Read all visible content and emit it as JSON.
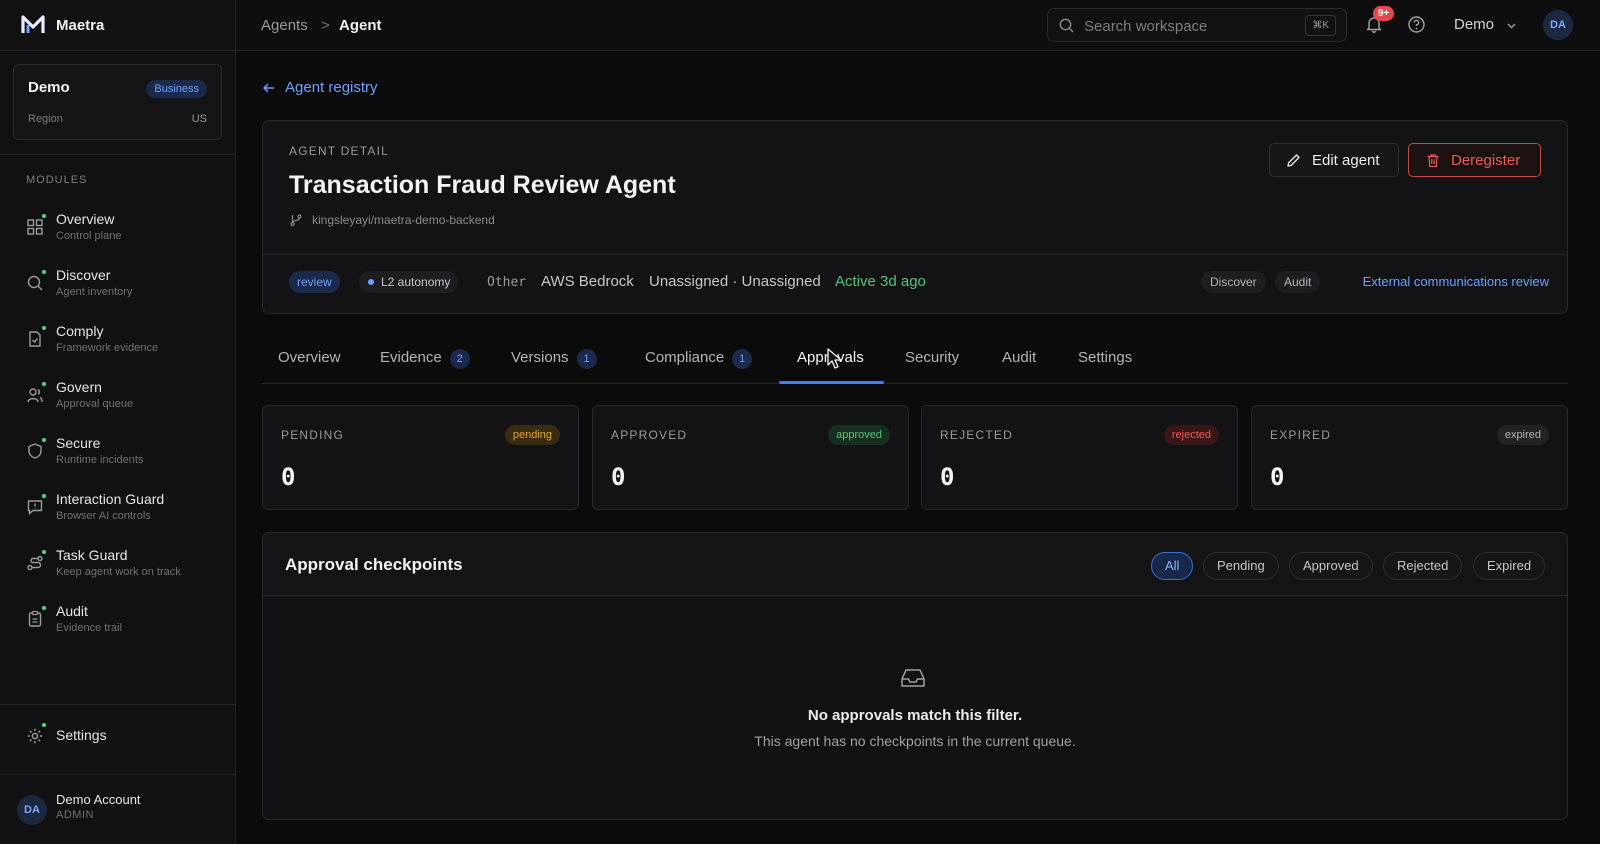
{
  "app": {
    "name": "Maetra"
  },
  "workspace": {
    "name": "Demo",
    "plan": "Business",
    "region_label": "Region",
    "region_value": "US"
  },
  "sidebar": {
    "section_label": "MODULES",
    "items": [
      {
        "title": "Overview",
        "subtitle": "Control plane",
        "icon": "grid-icon"
      },
      {
        "title": "Discover",
        "subtitle": "Agent inventory",
        "icon": "search-icon"
      },
      {
        "title": "Comply",
        "subtitle": "Framework evidence",
        "icon": "document-check-icon"
      },
      {
        "title": "Govern",
        "subtitle": "Approval queue",
        "icon": "users-icon"
      },
      {
        "title": "Secure",
        "subtitle": "Runtime incidents",
        "icon": "shield-icon"
      },
      {
        "title": "Interaction Guard",
        "subtitle": "Browser AI controls",
        "icon": "message-alert-icon"
      },
      {
        "title": "Task Guard",
        "subtitle": "Keep agent work on track",
        "icon": "route-icon"
      },
      {
        "title": "Audit",
        "subtitle": "Evidence trail",
        "icon": "clipboard-icon"
      }
    ],
    "settings_label": "Settings",
    "account": {
      "initials": "DA",
      "name": "Demo Account",
      "role": "ADMIN"
    }
  },
  "topbar": {
    "breadcrumb": [
      "Agents",
      "Agent"
    ],
    "breadcrumb_sep": ">",
    "search_placeholder": "Search workspace",
    "search_shortcut": "⌘K",
    "notifications_count": "9+",
    "user_menu_label": "Demo",
    "user_initials": "DA"
  },
  "back_link": {
    "label": "Agent registry"
  },
  "agent": {
    "eyebrow": "AGENT DETAIL",
    "title": "Transaction Fraud Review Agent",
    "repo": "kingsleyayi/maetra-demo-backend",
    "edit_label": "Edit agent",
    "deregister_label": "Deregister",
    "status_pill": "review",
    "autonomy_pill": "L2 autonomy",
    "category": "Other",
    "platform": "AWS Bedrock",
    "owners": "Unassigned · Unassigned",
    "activity": "Active 3d ago",
    "tags": [
      "Discover",
      "Audit"
    ],
    "linked_review": "External communications review"
  },
  "tabs": [
    {
      "label": "Overview",
      "count": null
    },
    {
      "label": "Evidence",
      "count": "2"
    },
    {
      "label": "Versions",
      "count": "1"
    },
    {
      "label": "Compliance",
      "count": "1"
    },
    {
      "label": "Approvals",
      "count": null,
      "active": true
    },
    {
      "label": "Security",
      "count": null
    },
    {
      "label": "Audit",
      "count": null
    },
    {
      "label": "Settings",
      "count": null
    }
  ],
  "stats": [
    {
      "label": "PENDING",
      "badge": "pending",
      "value": "0",
      "badge_color": "#e0a53a",
      "badge_bg": "#3a2c12"
    },
    {
      "label": "APPROVED",
      "badge": "approved",
      "value": "0",
      "badge_color": "#5cc27f",
      "badge_bg": "#15301f"
    },
    {
      "label": "REJECTED",
      "badge": "rejected",
      "value": "0",
      "badge_color": "#ef5b5b",
      "badge_bg": "#3a1616"
    },
    {
      "label": "EXPIRED",
      "badge": "expired",
      "value": "0",
      "badge_color": "#b4b4b9",
      "badge_bg": "#232326"
    }
  ],
  "checkpoints": {
    "title": "Approval checkpoints",
    "filters": [
      "All",
      "Pending",
      "Approved",
      "Rejected",
      "Expired"
    ],
    "active_filter": "All",
    "empty_title": "No approvals match this filter.",
    "empty_subtitle": "This agent has no checkpoints in the current queue."
  },
  "colors": {
    "accent": "#3b82f6",
    "link": "#6ea1ff",
    "danger": "#e5484d",
    "success": "#56c27a"
  }
}
